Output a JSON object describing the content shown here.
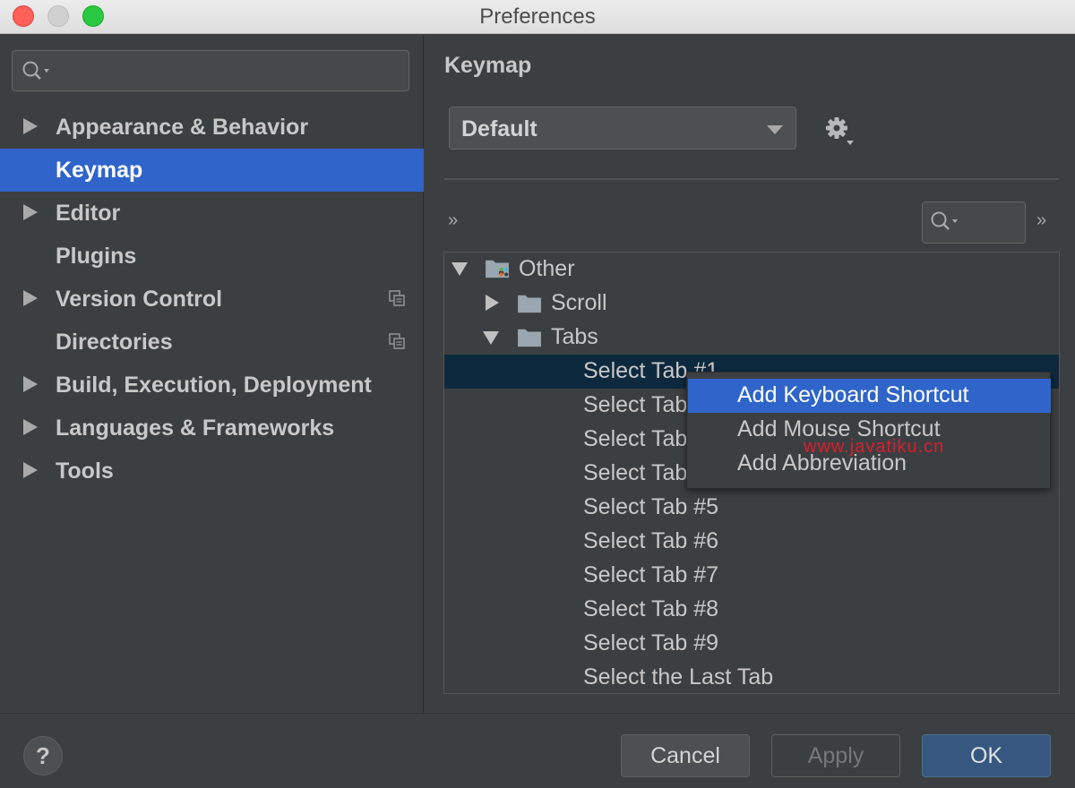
{
  "window": {
    "title": "Preferences"
  },
  "sidebar": {
    "search": {
      "value": "",
      "placeholder": ""
    },
    "items": [
      {
        "label": "Appearance & Behavior",
        "expandable": true,
        "selected": false,
        "project_icon": false
      },
      {
        "label": "Keymap",
        "expandable": false,
        "selected": true,
        "project_icon": false
      },
      {
        "label": "Editor",
        "expandable": true,
        "selected": false,
        "project_icon": false
      },
      {
        "label": "Plugins",
        "expandable": false,
        "selected": false,
        "project_icon": false
      },
      {
        "label": "Version Control",
        "expandable": true,
        "selected": false,
        "project_icon": true
      },
      {
        "label": "Directories",
        "expandable": false,
        "selected": false,
        "project_icon": true
      },
      {
        "label": "Build, Execution, Deployment",
        "expandable": true,
        "selected": false,
        "project_icon": false
      },
      {
        "label": "Languages & Frameworks",
        "expandable": true,
        "selected": false,
        "project_icon": false
      },
      {
        "label": "Tools",
        "expandable": true,
        "selected": false,
        "project_icon": false
      }
    ]
  },
  "main": {
    "title": "Keymap",
    "keymap_select": {
      "value": "Default"
    },
    "expand_label": "››",
    "collapse_label": "››",
    "filter": {
      "value": ""
    },
    "tree": {
      "other": "Other",
      "scroll": "Scroll",
      "tabs": "Tabs",
      "tab_items": [
        "Select Tab #1",
        "Select Tab #2",
        "Select Tab #3",
        "Select Tab #4",
        "Select Tab #5",
        "Select Tab #6",
        "Select Tab #7",
        "Select Tab #8",
        "Select Tab #9",
        "Select the Last Tab"
      ]
    },
    "context_menu": {
      "items": [
        "Add Keyboard Shortcut",
        "Add Mouse Shortcut",
        "Add Abbreviation"
      ],
      "highlighted": 0
    },
    "watermark": "www.javatiku.cn"
  },
  "footer": {
    "help_label": "?",
    "cancel_label": "Cancel",
    "apply_label": "Apply",
    "ok_label": "OK"
  },
  "colors": {
    "selection": "#2f65ca",
    "background": "#3c3f41",
    "tree_selection": "#0d293e",
    "ok_button": "#365880"
  }
}
